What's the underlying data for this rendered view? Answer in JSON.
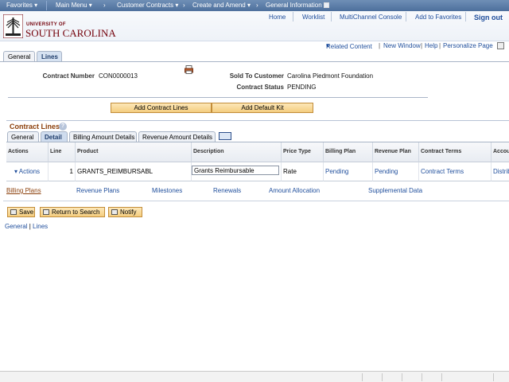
{
  "topnav": {
    "items": [
      "Favorites",
      "Main Menu",
      "Customer Contracts",
      "Create and Amend",
      "General Information"
    ]
  },
  "header": {
    "logo_line1": "UNIVERSITY OF",
    "logo_line2": "SOUTH CAROLINA",
    "links": [
      "Home",
      "Worklist",
      "MultiChannel Console",
      "Add to Favorites"
    ],
    "signout": "Sign out"
  },
  "relbar": {
    "related": "Related Content",
    "new_window": "New Window",
    "help": "Help",
    "personalize": "Personalize Page"
  },
  "pagetabs": [
    "General",
    "Lines"
  ],
  "contract": {
    "number_label": "Contract Number",
    "number": "CON0000013",
    "customer_label": "Sold To Customer",
    "customer": "Carolina Piedmont Foundation",
    "status_label": "Contract Status",
    "status": "PENDING"
  },
  "buttons": {
    "add_lines": "Add Contract Lines",
    "add_kit": "Add Default Kit"
  },
  "grid": {
    "title": "Contract Lines",
    "tabs": [
      "General",
      "Detail",
      "Billing Amount Details",
      "Revenue Amount Details"
    ],
    "headers": [
      "Actions",
      "Line",
      "Product",
      "Description",
      "Price Type",
      "Billing Plan",
      "Revenue Plan",
      "Contract Terms",
      "Accou"
    ],
    "row": {
      "actions": "Actions",
      "line": "1",
      "product": "GRANTS_REIMBURSABL",
      "description": "Grants Reimbursable",
      "price_type": "Rate",
      "billing_plan": "Pending",
      "revenue_plan": "Pending",
      "contract_terms": "Contract Terms",
      "account": "Distrib"
    }
  },
  "sublinks": [
    "Billing Plans",
    "Revenue Plans",
    "Milestones",
    "Renewals",
    "Amount Allocation",
    "Supplemental Data"
  ],
  "toolbar": {
    "save": "Save",
    "return": "Return to Search",
    "notify": "Notify"
  },
  "footer": {
    "general": "General",
    "sep": "|",
    "lines": "Lines"
  },
  "colors": {
    "brand": "#73000a",
    "link": "#1f4e9c",
    "section_title": "#8b3f0a",
    "button": "#f4cd7f"
  }
}
